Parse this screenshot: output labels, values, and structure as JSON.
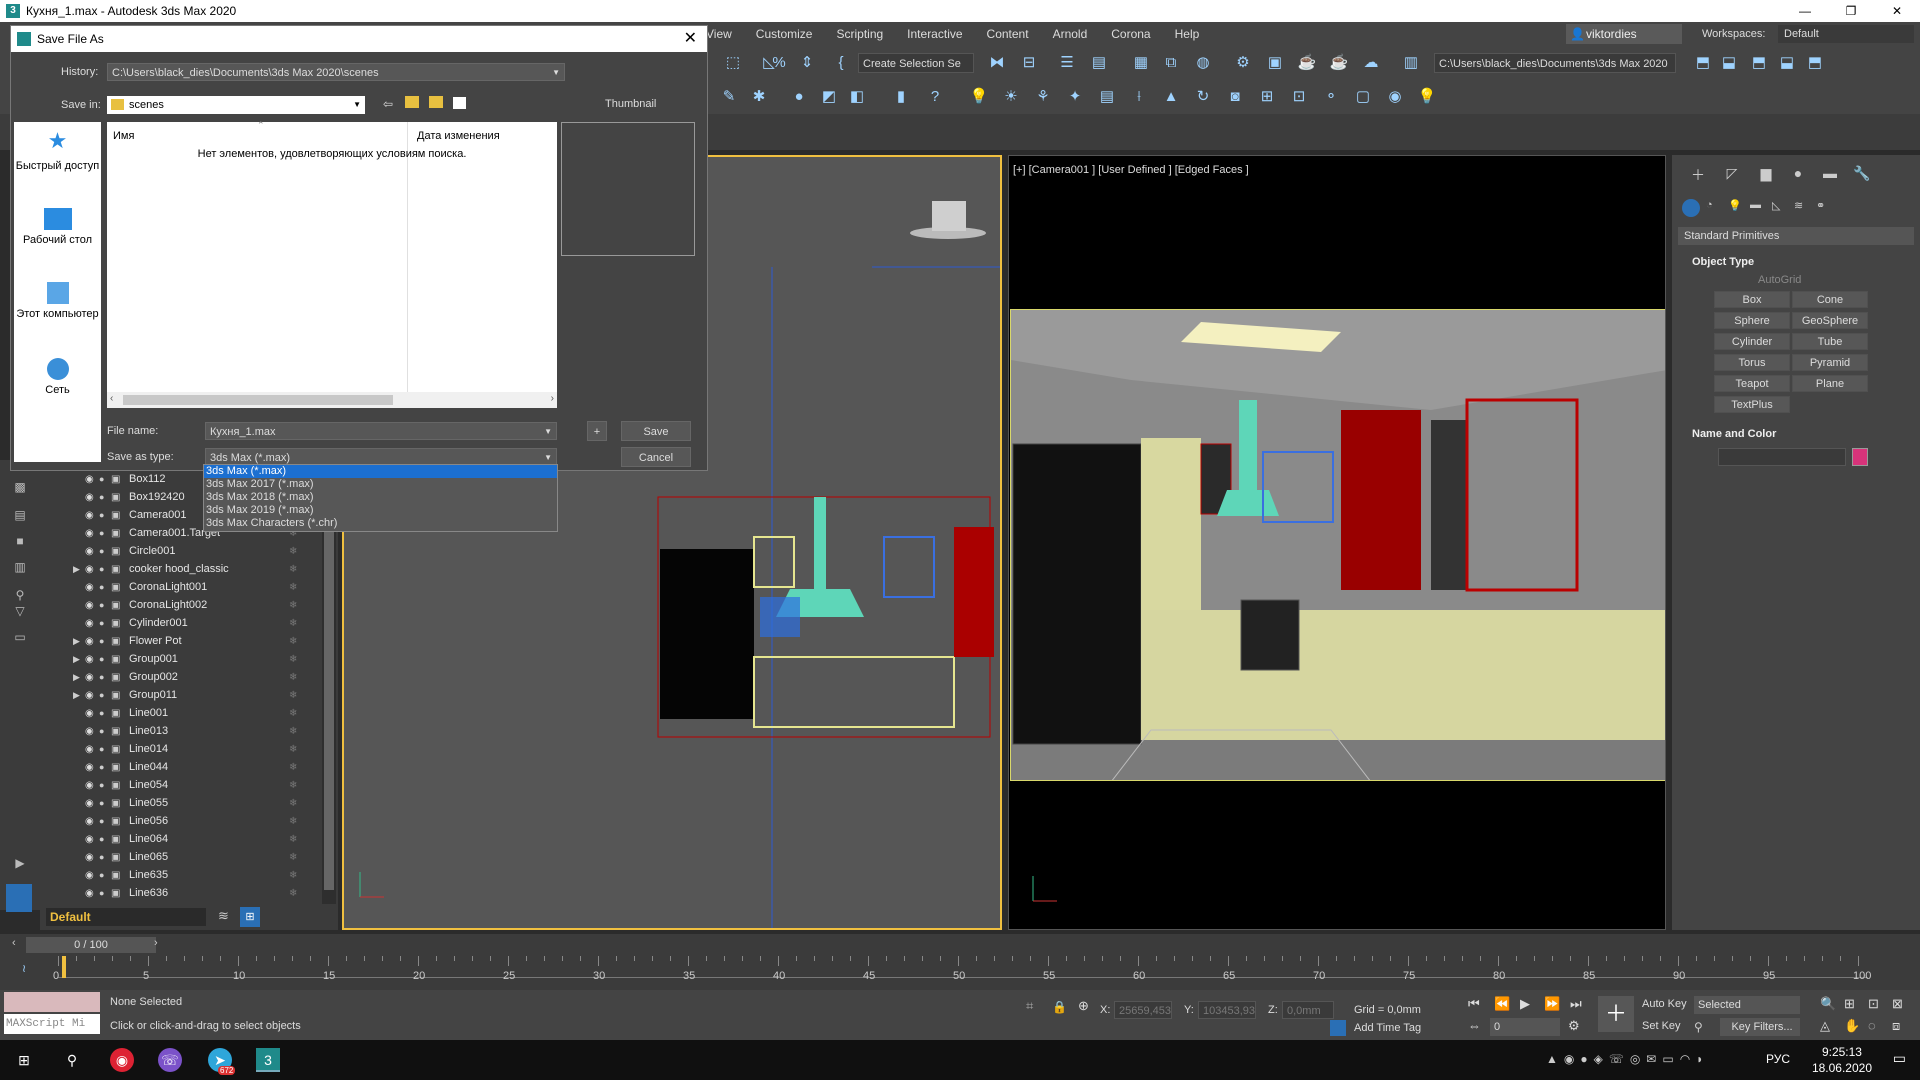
{
  "app": {
    "title": "Кухня_1.max - Autodesk 3ds Max 2020",
    "window_buttons": [
      "—",
      "❐",
      "✕"
    ]
  },
  "menubar": {
    "items": [
      "View",
      "Customize",
      "Scripting",
      "Interactive",
      "Content",
      "Arnold",
      "Corona",
      "Help"
    ],
    "user": "viktordies",
    "workspace_label": "Workspaces:",
    "workspace_value": "Default"
  },
  "toolbar": {
    "selection_set": "Create Selection Se",
    "project_path": "C:\\Users\\black_dies\\Documents\\3ds Max 2020"
  },
  "scene_explorer": {
    "items": [
      {
        "name": "Box112",
        "expandable": false
      },
      {
        "name": "Box192420",
        "expandable": false
      },
      {
        "name": "Camera001",
        "expandable": false
      },
      {
        "name": "Camera001.Target",
        "expandable": false
      },
      {
        "name": "Circle001",
        "expandable": false
      },
      {
        "name": "cooker hood_classic",
        "expandable": true
      },
      {
        "name": "CoronaLight001",
        "expandable": false
      },
      {
        "name": "CoronaLight002",
        "expandable": false
      },
      {
        "name": "Cylinder001",
        "expandable": false
      },
      {
        "name": "Flower Pot",
        "expandable": true
      },
      {
        "name": "Group001",
        "expandable": true
      },
      {
        "name": "Group002",
        "expandable": true
      },
      {
        "name": "Group011",
        "expandable": true
      },
      {
        "name": "Line001",
        "expandable": false
      },
      {
        "name": "Line013",
        "expandable": false
      },
      {
        "name": "Line014",
        "expandable": false
      },
      {
        "name": "Line044",
        "expandable": false
      },
      {
        "name": "Line054",
        "expandable": false
      },
      {
        "name": "Line055",
        "expandable": false
      },
      {
        "name": "Line056",
        "expandable": false
      },
      {
        "name": "Line064",
        "expandable": false
      },
      {
        "name": "Line065",
        "expandable": false
      },
      {
        "name": "Line635",
        "expandable": false
      },
      {
        "name": "Line636",
        "expandable": false
      }
    ],
    "layer": "Default"
  },
  "viewport_right": {
    "label": "[+] [Camera001 ] [User Defined ] [Edged Faces ]"
  },
  "command_panel": {
    "category": "Standard Primitives",
    "object_type_title": "Object Type",
    "autogrid": "AutoGrid",
    "primitives": [
      "Box",
      "Cone",
      "Sphere",
      "GeoSphere",
      "Cylinder",
      "Tube",
      "Torus",
      "Pyramid",
      "Teapot",
      "Plane",
      "TextPlus"
    ],
    "name_color_title": "Name and Color"
  },
  "timeline": {
    "frame_display": "0 / 100",
    "ticks": [
      0,
      5,
      10,
      15,
      20,
      25,
      30,
      35,
      40,
      45,
      50,
      55,
      60,
      65,
      70,
      75,
      80,
      85,
      90,
      95,
      100
    ]
  },
  "statusbar": {
    "maxscript": "MAXScript Mi",
    "selection": "None Selected",
    "prompt": "Click or click-and-drag to select objects",
    "x_label": "X:",
    "x_value": "25659,453",
    "y_label": "Y:",
    "y_value": "103453,93",
    "z_label": "Z:",
    "z_value": "0,0mm",
    "grid": "Grid = 0,0mm",
    "add_time_tag": "Add Time Tag",
    "auto_key": "Auto Key",
    "set_key": "Set Key",
    "selected": "Selected",
    "key_filters": "Key Filters...",
    "frame": "0"
  },
  "taskbar": {
    "lang": "РУС",
    "time": "9:25:13",
    "date": "18.06.2020",
    "telegram_badge": "672"
  },
  "dialog": {
    "title": "Save File As",
    "history_label": "History:",
    "history_value": "C:\\Users\\black_dies\\Documents\\3ds Max 2020\\scenes",
    "save_in_label": "Save in:",
    "save_in_value": "scenes",
    "thumbnail_label": "Thumbnail",
    "places": [
      "Быстрый доступ",
      "Рабочий стол",
      "Этот компьютер",
      "Сеть"
    ],
    "col_name": "Имя",
    "col_date": "Дата изменения",
    "empty_message": "Нет элементов, удовлетворяющих условиям поиска.",
    "file_name_label": "File name:",
    "file_name_value": "Кухня_1.max",
    "save_as_type_label": "Save as type:",
    "save_as_type_value": "3ds Max (*.max)",
    "plus_label": "+",
    "save_label": "Save",
    "cancel_label": "Cancel",
    "type_options": [
      "3ds Max (*.max)",
      "3ds Max 2017 (*.max)",
      "3ds Max 2018 (*.max)",
      "3ds Max 2019 (*.max)",
      "3ds Max Characters (*.chr)"
    ]
  },
  "colors": {
    "accent": "#1c6fd0",
    "viewport_active": "#f0c040",
    "swatch": "#d8337a"
  }
}
